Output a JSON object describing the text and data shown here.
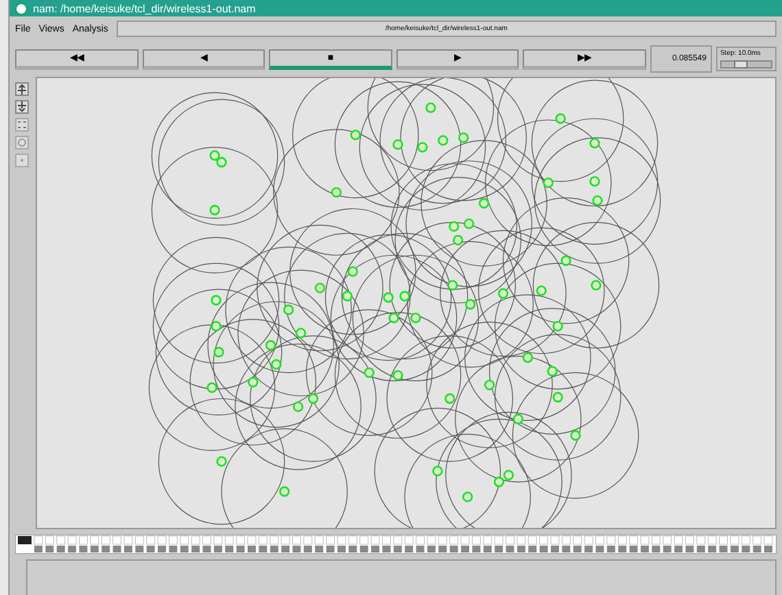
{
  "window": {
    "title": "nam: /home/keisuke/tcl_dir/wireless1-out.nam"
  },
  "menu": [
    "File",
    "Views",
    "Analysis"
  ],
  "path_field": {
    "value": "/home/keisuke/tcl_dir/wireless1-out.nam"
  },
  "controls": [
    {
      "label": "◀◀",
      "selected": false
    },
    {
      "label": "◀",
      "selected": false
    },
    {
      "label": "■",
      "selected": true
    },
    {
      "label": "▶",
      "selected": false
    },
    {
      "label": "▶▶",
      "selected": false
    }
  ],
  "time": "0.085549",
  "step": {
    "label": "Step: 10.0ms",
    "level": 0.3
  }
}
